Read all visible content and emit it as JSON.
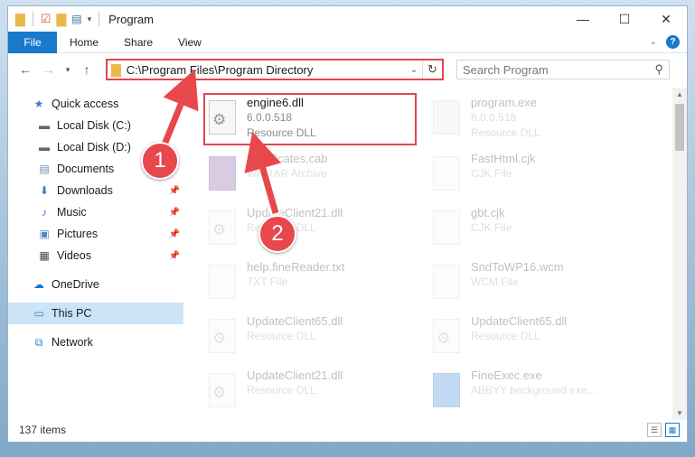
{
  "window": {
    "title": "Program",
    "controls": {
      "minimize": "—",
      "maximize": "☐",
      "close": "✕"
    }
  },
  "ribbon": {
    "tabs": [
      "File",
      "Home",
      "Share",
      "View"
    ],
    "help_label": "?"
  },
  "navigation": {
    "address": "C:\\Program Files\\Program Directory",
    "search_placeholder": "Search Program"
  },
  "sidebar": {
    "items": [
      {
        "label": "Quick access",
        "icon": "star-icon"
      },
      {
        "label": "Local Disk (C:)",
        "icon": "drive-icon"
      },
      {
        "label": "Local Disk (D:)",
        "icon": "drive-icon"
      },
      {
        "label": "Documents",
        "icon": "documents-icon"
      },
      {
        "label": "Downloads",
        "icon": "download-icon"
      },
      {
        "label": "Music",
        "icon": "music-icon"
      },
      {
        "label": "Pictures",
        "icon": "pictures-icon"
      },
      {
        "label": "Videos",
        "icon": "videos-icon"
      },
      {
        "label": "OneDrive",
        "icon": "cloud-icon"
      },
      {
        "label": "This PC",
        "icon": "computer-icon"
      },
      {
        "label": "Network",
        "icon": "network-icon"
      }
    ]
  },
  "files": [
    {
      "name": "engine6.dll",
      "line2": "6.0.0.518",
      "line3": "Resource DLL"
    },
    {
      "name": "program.exe",
      "line2": "6.0.0.518",
      "line3": "Resource DLL"
    },
    {
      "name": "Certificates.cab",
      "line2": "WinRAR Archive",
      "line3": ""
    },
    {
      "name": "FastHtml.cjk",
      "line2": "CJK File",
      "line3": ""
    },
    {
      "name": "UpdateClient21.dll",
      "line2": "Resource DLL",
      "line3": ""
    },
    {
      "name": "gbt.cjk",
      "line2": "CJK File",
      "line3": ""
    },
    {
      "name": "help.fineReader.txt",
      "line2": "TXT File",
      "line3": ""
    },
    {
      "name": "SndToWP16.wcm",
      "line2": "WCM File",
      "line3": ""
    },
    {
      "name": "UpdateClient65.dll",
      "line2": "Resource DLL",
      "line3": ""
    },
    {
      "name": "UpdateClient65.dll",
      "line2": "Resource DLL",
      "line3": ""
    },
    {
      "name": "UpdateClient21.dll",
      "line2": "Resource DLL",
      "line3": ""
    },
    {
      "name": "FineExec.exe",
      "line2": "ABBYY background exe...",
      "line3": ""
    }
  ],
  "status": {
    "count": "137 items"
  },
  "annotations": {
    "step1": "1",
    "step2": "2"
  },
  "colors": {
    "accent": "#1979ca",
    "highlight": "#e0474c"
  }
}
